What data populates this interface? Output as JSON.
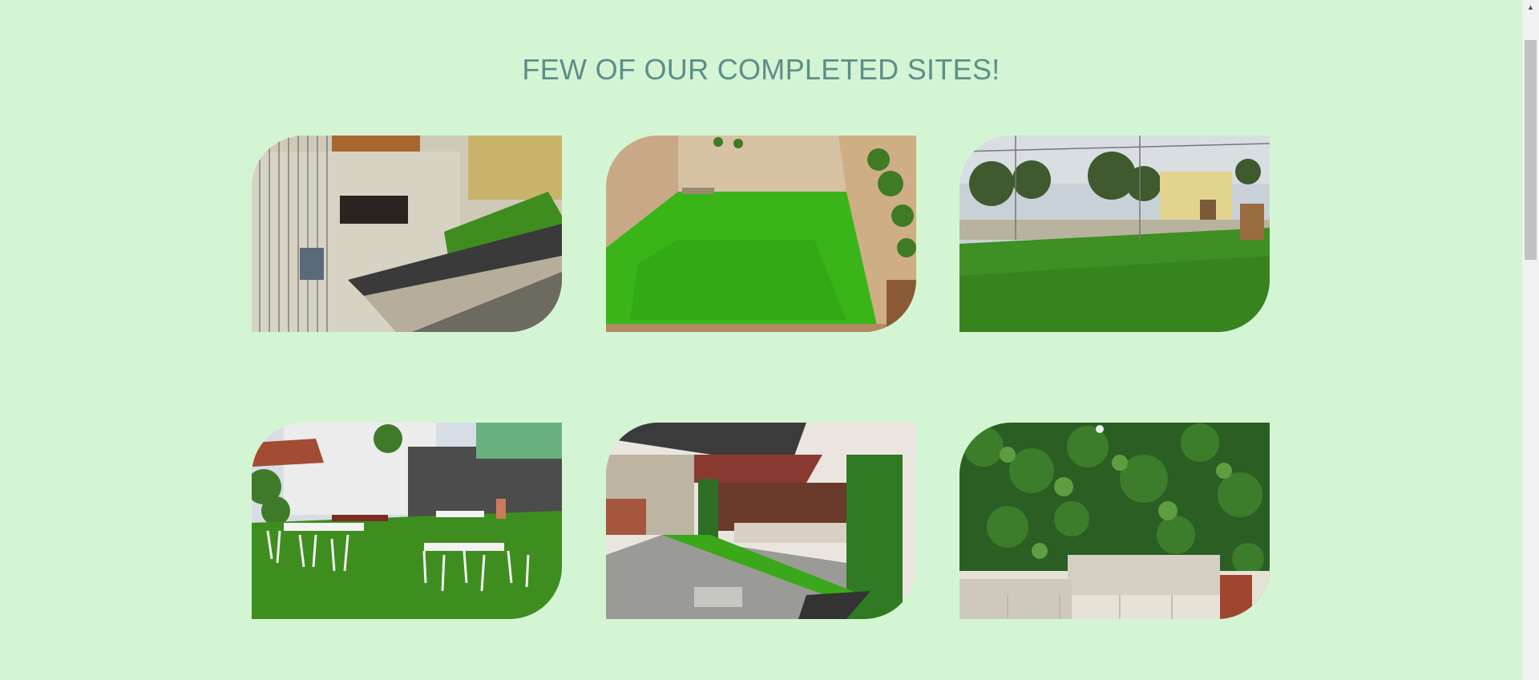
{
  "section": {
    "title": "FEW OF OUR COMPLETED SITES!"
  },
  "gallery": [
    {
      "name": "site-photo-terrace-lawn",
      "alt": "Terrace lawn with artificial grass"
    },
    {
      "name": "site-photo-backyard-lawn",
      "alt": "Backyard artificial grass"
    },
    {
      "name": "site-photo-rooftop-lawn",
      "alt": "Rooftop artificial lawn with palms"
    },
    {
      "name": "site-photo-garden-seating",
      "alt": "Garden lawn with white chairs"
    },
    {
      "name": "site-photo-patio-lawn",
      "alt": "Patio with green wall and grass strip"
    },
    {
      "name": "site-photo-green-wall",
      "alt": "Vertical green wall behind sofa"
    }
  ],
  "colors": {
    "background": "#d4f5d3",
    "title": "#5c8e8b",
    "grass": "#3aa81a"
  },
  "scrollbar": {
    "up_icon": "chevron-up-icon"
  }
}
